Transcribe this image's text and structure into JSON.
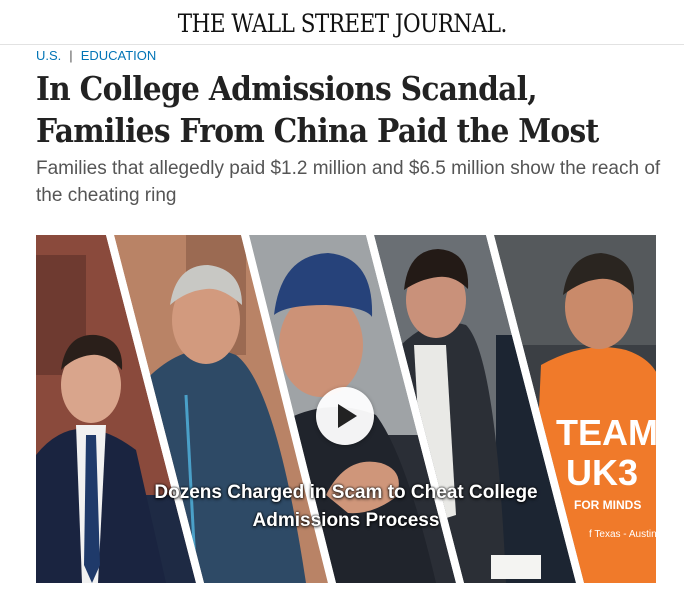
{
  "masthead": {
    "logo_text": "THE WALL STREET JOURNAL."
  },
  "breadcrumb": {
    "section": "U.S.",
    "subsection": "EDUCATION"
  },
  "article": {
    "headline_line1": "In College Admissions Scandal,",
    "headline_line2": "Families From China Paid the Most",
    "dek": "Families that allegedly paid $1.2 million and $6.5 million show the reach of the cheating ring"
  },
  "video": {
    "caption_line1": "Dozens Charged in Scam to Cheat College",
    "caption_line2": "Admissions Process",
    "play_icon": "play-icon",
    "shirt_text_line1": "TEAM",
    "shirt_text_line2": "UK3",
    "shirt_text_line3": "FOR MINDS",
    "shirt_text_line4": "f Texas - Austin"
  },
  "colors": {
    "link": "#0274b6",
    "headline": "#222222",
    "dek": "#555555",
    "shirt": "#f07a2a"
  }
}
